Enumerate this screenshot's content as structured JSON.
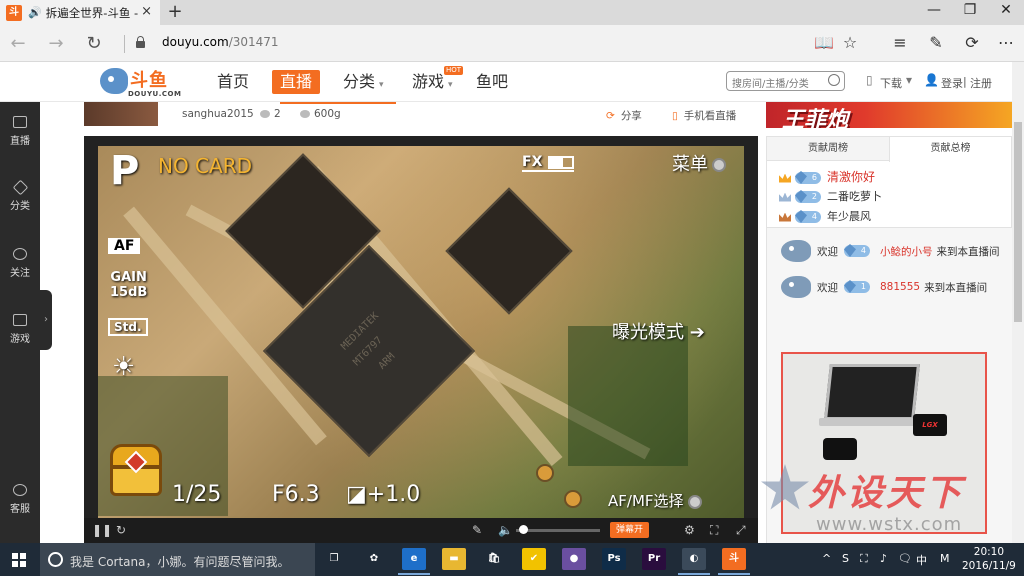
{
  "browser": {
    "tab_title": "拆遍全世界-斗鱼 - 每",
    "tab_close": "×",
    "new_tab": "+",
    "speaker_icon": "speaker-icon",
    "favicon_text": "斗",
    "window_controls": [
      "—",
      "❐",
      "✕"
    ],
    "url_domain": "douyu.com",
    "url_path": "/301471",
    "nav": {
      "back": "←",
      "forward": "→",
      "refresh": "↻"
    },
    "toolbar_icons": [
      "📖",
      "☆",
      "≡",
      "✎",
      "⟳",
      "⋯"
    ]
  },
  "header": {
    "logo_text": "斗鱼",
    "logo_sub": "DOUYU.COM",
    "nav": [
      {
        "label": "首页",
        "active": false
      },
      {
        "label": "直播",
        "active": true
      },
      {
        "label": "分类",
        "active": false
      },
      {
        "label": "游戏",
        "active": false
      },
      {
        "label": "鱼吧",
        "active": false
      }
    ],
    "hot_badge": "HOT",
    "search_placeholder": "搜房间/主播/分类",
    "download": "下载",
    "login": "登录",
    "divider": "|",
    "register": "注册"
  },
  "sidebar": {
    "items": [
      {
        "label": "直播",
        "icon": "tv-icon"
      },
      {
        "label": "分类",
        "icon": "layers-icon"
      },
      {
        "label": "关注",
        "icon": "heart-icon"
      },
      {
        "label": "游戏",
        "icon": "gamepad-icon"
      },
      {
        "label": "客服",
        "icon": "headset-icon"
      }
    ],
    "expand": "›"
  },
  "room": {
    "anchor": "sanghua2015",
    "comments": "2",
    "weight": "600g",
    "share": "分享",
    "mobile_watch": "手机看直播"
  },
  "player": {
    "osd": {
      "mode": "P",
      "no_card": "NO CARD",
      "fx": "FX",
      "menu": "菜单",
      "af": "AF",
      "gain_label": "GAIN",
      "gain_value": "15dB",
      "picture_style": "Std.",
      "wb": "☀",
      "exposure_mode": "曝光模式",
      "exposure_arrow": "➔",
      "shutter": "1/25",
      "fnumber": "F6.3",
      "ev": "+1.0",
      "ev_icon": "◪",
      "afmf": "AF/MF选择"
    },
    "chip_labels": [
      "MEDIATEK",
      "MT6797",
      "ARM"
    ],
    "controls": {
      "play": "❚❚",
      "refresh": "↻",
      "danmu": "弹幕开",
      "volume_pct": 3
    }
  },
  "right_panel": {
    "banner_text": "王菲炮",
    "rank_tabs": [
      {
        "label": "贡献周榜",
        "active": false
      },
      {
        "label": "贡献总榜",
        "active": true
      }
    ],
    "ranks": [
      {
        "name": "清激你好",
        "level": "6",
        "crown": "#f5a623",
        "name_color": "#d9342b"
      },
      {
        "name": "二番吃萝卜",
        "level": "2",
        "crown": "#9cb6d4",
        "name_color": "#333333"
      },
      {
        "name": "年少晨风",
        "level": "4",
        "crown": "#c9773a",
        "name_color": "#333333"
      }
    ],
    "chat": [
      {
        "prefix": "欢迎",
        "level": "4",
        "user": "小鲶的小号",
        "suffix": "来到本直播间"
      },
      {
        "prefix": "欢迎",
        "level": "1",
        "user": "881555",
        "suffix": "来到本直播间"
      }
    ],
    "ad": {
      "capture_label": "LGX"
    },
    "watermark": {
      "text": "外设天下",
      "url": "www.wstx.com"
    }
  },
  "taskbar": {
    "cortana": "我是 Cortana，小娜。有问题尽管问我。",
    "apps": [
      {
        "name": "task-view",
        "label": "❐",
        "color": "transparent",
        "running": false
      },
      {
        "name": "pinwheel",
        "label": "✿",
        "color": "transparent",
        "running": false
      },
      {
        "name": "edge",
        "label": "e",
        "color": "#1e6fc9",
        "running": true
      },
      {
        "name": "explorer",
        "label": "▬",
        "color": "#e8b731",
        "running": false
      },
      {
        "name": "store",
        "label": "🛍",
        "color": "transparent",
        "running": false
      },
      {
        "name": "norton",
        "label": "✔",
        "color": "#f2c200",
        "running": false
      },
      {
        "name": "chrome",
        "label": "●",
        "color": "#6a4fa0",
        "running": false
      },
      {
        "name": "photoshop",
        "label": "Ps",
        "color": "#0f2c48",
        "running": false
      },
      {
        "name": "premiere",
        "label": "Pr",
        "color": "#2a0d3e",
        "running": false
      },
      {
        "name": "app-running-1",
        "label": "◐",
        "color": "#3b4a5a",
        "running": true
      },
      {
        "name": "douyu-app",
        "label": "斗",
        "color": "#f36d21",
        "running": true
      }
    ],
    "tray": [
      "^",
      "S",
      "⛶",
      "♪",
      "🗨",
      "中",
      "M"
    ],
    "time": "20:10",
    "date": "2016/11/9"
  }
}
